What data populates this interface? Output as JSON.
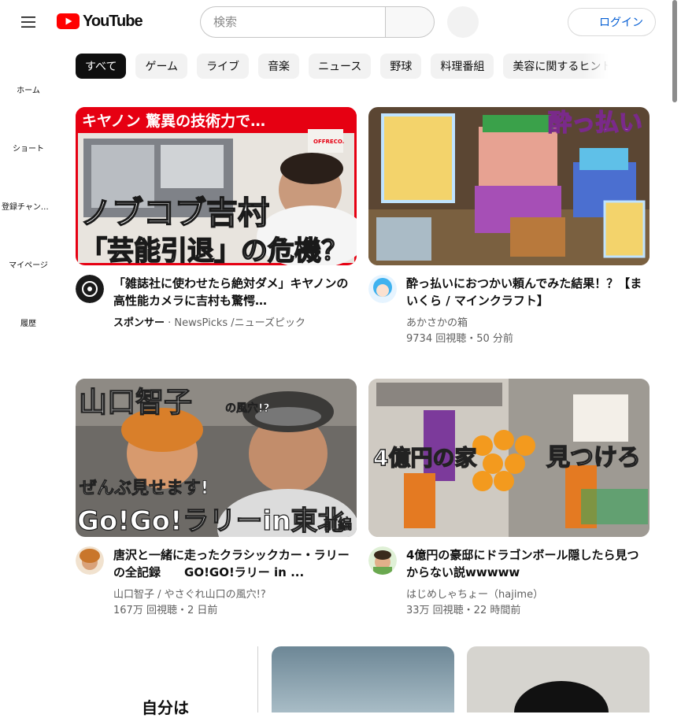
{
  "header": {
    "logo_text": "YouTube",
    "search_placeholder": "検索",
    "login_label": "ログイン"
  },
  "sidebar": {
    "items": [
      {
        "label": "ホーム",
        "icon": "home-icon"
      },
      {
        "label": "ショート",
        "icon": "shorts-icon"
      },
      {
        "label": "登録チャンネル",
        "icon": "subscriptions-icon"
      },
      {
        "label": "マイページ",
        "icon": "you-icon"
      },
      {
        "label": "履歴",
        "icon": "history-icon"
      }
    ]
  },
  "chips": [
    "すべて",
    "ゲーム",
    "ライブ",
    "音楽",
    "ニュース",
    "野球",
    "料理番組",
    "美容に関するヒント"
  ],
  "videos": [
    {
      "title": "「雑誌社に使わせたら絶対ダメ」キヤノンの高性能カメラに吉村も驚愕…",
      "sponsor": "スポンサー",
      "channel": "NewsPicks /ニューズピック",
      "stats": "",
      "thumb_top": "キヤノン 驚異の技術力で…",
      "thumb_line1": "ノブコブ吉村",
      "thumb_line2": "「芸能引退」の危機？",
      "thumb_badge": "OFFRECO."
    },
    {
      "title": "酔っ払いにおつかい頼んでみた結果！？【まいくら / マインクラフト】",
      "channel": "あかさかの箱",
      "stats": "9734 回視聴・50 分前",
      "thumb_text": "酔っ払い"
    },
    {
      "title": "唐沢と一緒に走ったクラシックカー・ラリーの全記録　　GO!GO!ラリー in ...",
      "channel": "山口智子 / やさぐれ山口の風穴!?",
      "stats": "167万 回視聴・2 日前",
      "thumb_top": "山口智子",
      "thumb_top_small": "の風穴!?",
      "thumb_mid": "ぜんぶ見せます!",
      "thumb_bottom": "Go!Go!ラリーin東北",
      "thumb_bottom_small": "前編"
    },
    {
      "title": "4億円の豪邸にドラゴンボール隠したら見つからない説wwwww",
      "channel": "はじめしゃちょー（hajime）",
      "stats": "33万 回視聴・22 時間前",
      "thumb_left": "4億円の家",
      "thumb_right": "見つけろ"
    }
  ],
  "next_row": {
    "partial_text": "自分は"
  },
  "colors": {
    "brand_red": "#ff0000",
    "link_blue": "#065fd4",
    "chip_bg": "#f2f2f2",
    "active_chip_bg": "#0f0f0f",
    "meta_gray": "#606060"
  }
}
